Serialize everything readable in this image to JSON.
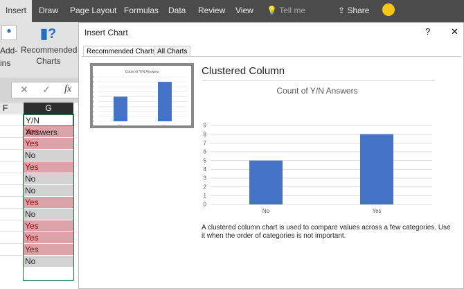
{
  "ribbon_tabs": [
    "Insert",
    "Draw",
    "Page Layout",
    "Formulas",
    "Data",
    "Review",
    "View",
    "Tell me"
  ],
  "share_label": "Share",
  "ribbon": {
    "addins": "Add-ins",
    "recommended": "Recommended Charts"
  },
  "formula_bar": {
    "cancel": "✕",
    "enter": "✓",
    "fx": "fx"
  },
  "sheet": {
    "columns": [
      "F",
      "G"
    ],
    "header": "Y/N Answers",
    "values": [
      "Yes",
      "Yes",
      "No",
      "Yes",
      "No",
      "No",
      "Yes",
      "No",
      "Yes",
      "Yes",
      "Yes",
      "No"
    ]
  },
  "dialog": {
    "title": "Insert Chart",
    "help": "?",
    "close": "✕",
    "tabs": [
      "Recommended Charts",
      "All Charts"
    ],
    "chart_type": "Clustered Column",
    "description": "A clustered column chart is used to compare values across a few categories. Use it when the order of categories is not important."
  },
  "colors": {
    "bar": "#4472c4",
    "yes_fill": "#d9a3a8",
    "no_fill": "#d2d2d2"
  },
  "chart_data": {
    "type": "bar",
    "title": "Count of Y/N Answers",
    "categories": [
      "No",
      "Yes"
    ],
    "values": [
      5,
      8
    ],
    "ylim": [
      0,
      9
    ],
    "yticks": [
      0,
      1,
      2,
      3,
      4,
      5,
      6,
      7,
      8,
      9
    ],
    "grid": true,
    "xlabel": "",
    "ylabel": ""
  }
}
